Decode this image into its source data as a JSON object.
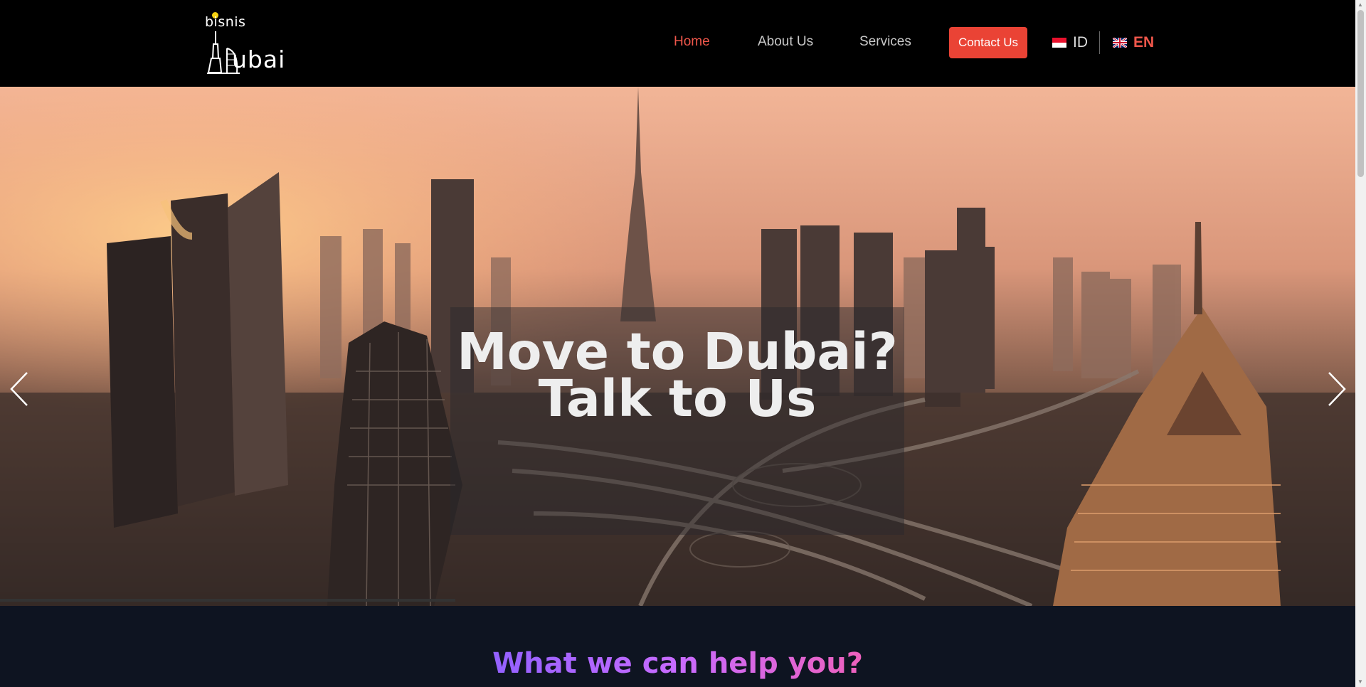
{
  "header": {
    "logo": {
      "small_text": "bisnis",
      "big_text": "ubai"
    },
    "nav": [
      {
        "label": "Home",
        "active": true
      },
      {
        "label": "About Us",
        "active": false
      },
      {
        "label": "Services",
        "active": false
      }
    ],
    "contact_button": "Contact Us",
    "languages": [
      {
        "code": "ID",
        "flag": "indonesia-flag-icon",
        "active": false
      },
      {
        "code": "EN",
        "flag": "uk-flag-icon",
        "active": true
      }
    ]
  },
  "hero": {
    "title_line1": "Move to Dubai?",
    "title_line2": "Talk to Us",
    "prev_icon": "chevron-left-icon",
    "next_icon": "chevron-right-icon"
  },
  "section": {
    "title": "What we can help you?"
  },
  "colors": {
    "accent": "#ea4335",
    "active_nav": "#f0574b",
    "header_bg": "#000000",
    "section_bg": "#0e1421",
    "gradient_start": "#7b5cff",
    "gradient_end": "#ff5c9d"
  }
}
